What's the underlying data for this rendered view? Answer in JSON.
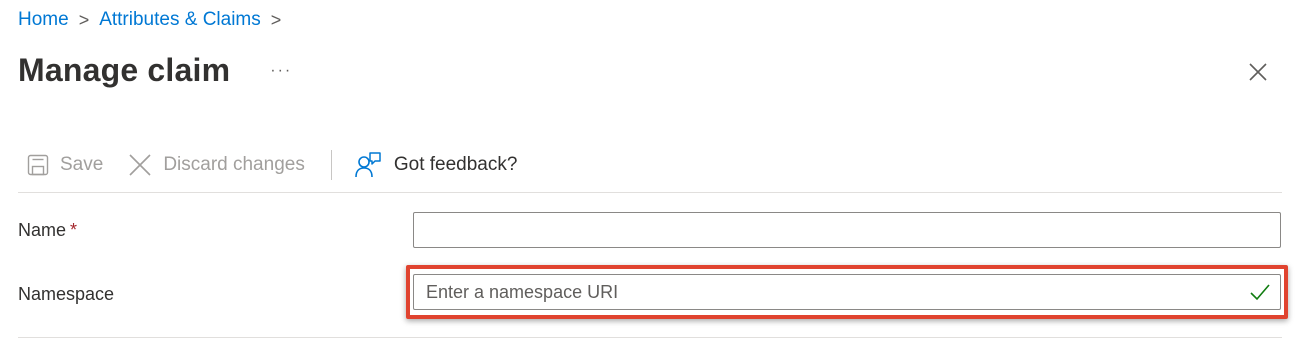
{
  "breadcrumb": {
    "items": [
      "Home",
      "Attributes & Claims"
    ],
    "separator": ">"
  },
  "header": {
    "title": "Manage claim",
    "more_label": "···"
  },
  "toolbar": {
    "save_label": "Save",
    "discard_label": "Discard changes",
    "feedback_label": "Got feedback?"
  },
  "form": {
    "name": {
      "label": "Name",
      "required_marker": "*",
      "value": "",
      "placeholder": ""
    },
    "namespace": {
      "label": "Namespace",
      "value": "",
      "placeholder": "Enter a namespace URI",
      "valid": true
    }
  },
  "colors": {
    "link": "#0078d4",
    "required": "#a4262c",
    "highlight": "#e0432f",
    "valid_check": "#107c10",
    "disabled": "#a19f9d"
  },
  "icons": {
    "save": "save-icon",
    "discard": "close-icon",
    "feedback": "feedback-icon",
    "close": "close-icon",
    "valid": "checkmark-icon"
  }
}
